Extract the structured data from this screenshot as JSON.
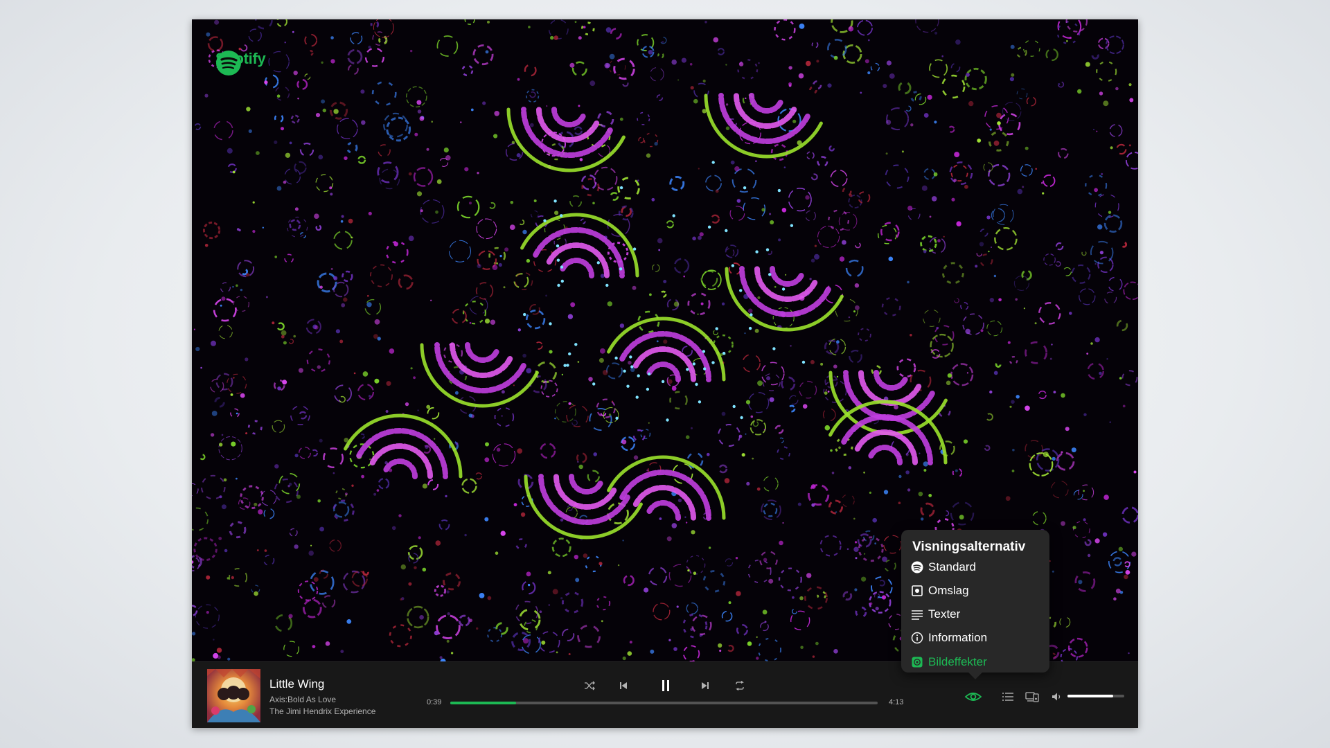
{
  "app": {
    "brand": "Spotify",
    "brand_color": "#1db954"
  },
  "view_options": {
    "title": "Visningsalternativ",
    "items": [
      {
        "label": "Standard",
        "icon": "spotify-icon",
        "active": false
      },
      {
        "label": "Omslag",
        "icon": "cover-art-icon",
        "active": false
      },
      {
        "label": "Texter",
        "icon": "lyrics-icon",
        "active": false
      },
      {
        "label": "Information",
        "icon": "info-icon",
        "active": false
      },
      {
        "label": "Bildeffekter",
        "icon": "visualizer-icon",
        "active": true
      }
    ]
  },
  "now_playing": {
    "title": "Little Wing",
    "album": "Axis:Bold As Love",
    "artist": "The Jimi Hendrix Experience"
  },
  "player": {
    "elapsed": "0:39",
    "duration": "4:13",
    "progress": 0.154,
    "state": "playing",
    "volume": 0.8
  },
  "colors": {
    "accent": "#1db954",
    "bar_bg": "#181818",
    "popover_bg": "#282828"
  }
}
